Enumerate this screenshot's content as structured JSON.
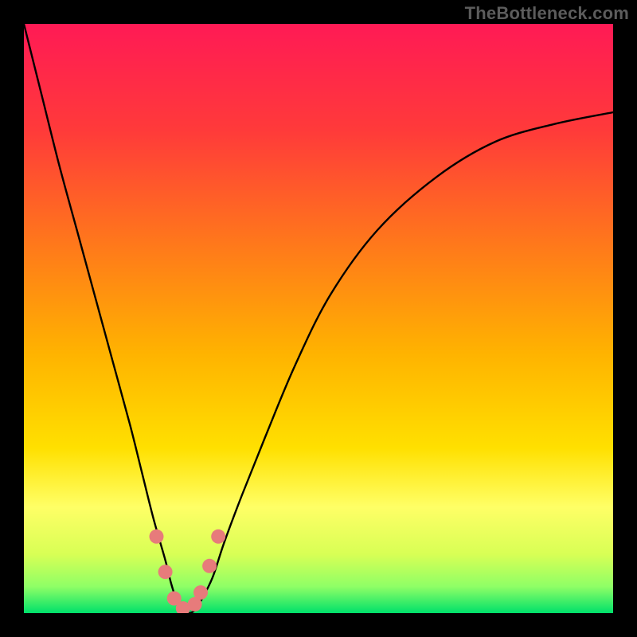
{
  "watermark": "TheBottleneck.com",
  "chart_data": {
    "type": "line",
    "title": "",
    "xlabel": "",
    "ylabel": "",
    "xlim": [
      0,
      100
    ],
    "ylim": [
      0,
      100
    ],
    "background_gradient": {
      "direction": "vertical",
      "stops": [
        {
          "offset": 0.0,
          "color": "#ff1a55"
        },
        {
          "offset": 0.18,
          "color": "#ff3a3a"
        },
        {
          "offset": 0.38,
          "color": "#ff7a1a"
        },
        {
          "offset": 0.56,
          "color": "#ffb300"
        },
        {
          "offset": 0.72,
          "color": "#ffe000"
        },
        {
          "offset": 0.82,
          "color": "#ffff66"
        },
        {
          "offset": 0.9,
          "color": "#d8ff55"
        },
        {
          "offset": 0.955,
          "color": "#8fff66"
        },
        {
          "offset": 1.0,
          "color": "#00e06a"
        }
      ]
    },
    "series": [
      {
        "name": "bottleneck-curve",
        "color": "#000000",
        "x": [
          0,
          3,
          6,
          9,
          12,
          15,
          18,
          20,
          22,
          24,
          25,
          26,
          27,
          28,
          29,
          30,
          32,
          34,
          37,
          41,
          46,
          52,
          60,
          70,
          80,
          90,
          100
        ],
        "values": [
          100,
          88,
          76,
          65,
          54,
          43,
          32,
          24,
          16,
          9,
          5,
          2,
          0.5,
          0,
          0.5,
          2,
          6,
          12,
          20,
          30,
          42,
          54,
          65,
          74,
          80,
          83,
          85
        ]
      }
    ],
    "markers": {
      "name": "highlight-points",
      "color": "#e77b7b",
      "radius_px": 9,
      "points": [
        {
          "x": 22.5,
          "y": 13
        },
        {
          "x": 24.0,
          "y": 7
        },
        {
          "x": 25.5,
          "y": 2.5
        },
        {
          "x": 27.0,
          "y": 0.8
        },
        {
          "x": 29.0,
          "y": 1.5
        },
        {
          "x": 30.0,
          "y": 3.5
        },
        {
          "x": 31.5,
          "y": 8
        },
        {
          "x": 33.0,
          "y": 13
        }
      ]
    },
    "frame_color": "#000000"
  }
}
